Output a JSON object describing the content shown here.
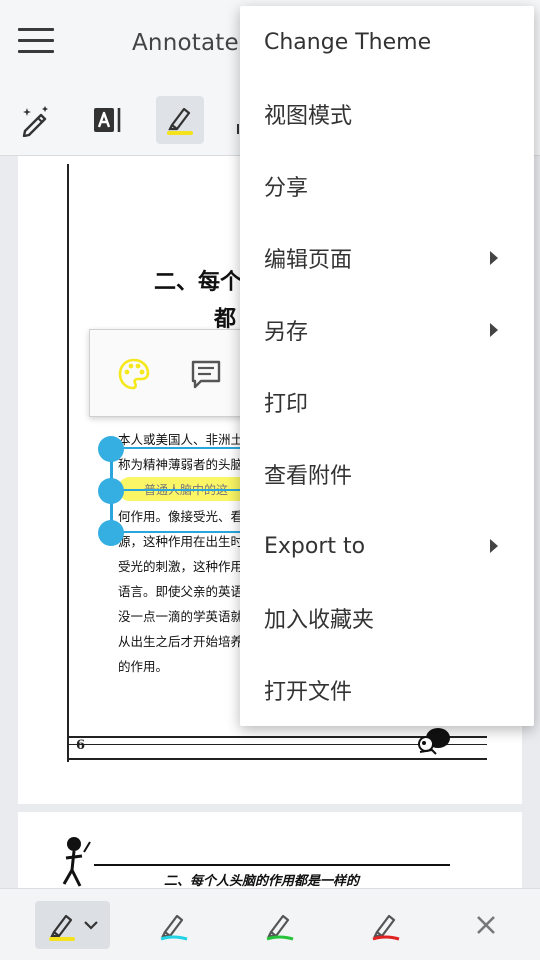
{
  "app_bar": {
    "title": "Annotate",
    "menu_icon": "hamburger-menu-icon",
    "tools": [
      {
        "name": "magic-pen-icon",
        "active": false
      },
      {
        "name": "text-cursor-icon",
        "active": false
      },
      {
        "name": "highlighter-icon",
        "active": true
      }
    ]
  },
  "document": {
    "heading_line1": "二、每个",
    "heading_line2": "都",
    "lines": [
      "本人或美国人、非洲土",
      "称为精神薄弱者的头脑",
      "何作用。像接受光、看",
      "源，这种作用在出生时",
      "受光的刺激，这种作用",
      "语言。即使父亲的英语",
      "没一点一滴的学英语就",
      "从出生之后才开始培养",
      "的作用。"
    ],
    "highlighted_text": "普通人脑中的这",
    "page_number": "6",
    "page2_heading": "二、每个人头脑的作用都是一样的"
  },
  "annotation_popup": {
    "buttons": [
      "palette-icon",
      "comment-icon"
    ],
    "palette_color": "#f5e81c"
  },
  "overflow_menu": {
    "items": [
      {
        "label": "Change Theme",
        "submenu": false
      },
      {
        "label": "视图模式",
        "submenu": false
      },
      {
        "label": "分享",
        "submenu": false
      },
      {
        "label": "编辑页面",
        "submenu": true
      },
      {
        "label": "另存",
        "submenu": true
      },
      {
        "label": "打印",
        "submenu": false
      },
      {
        "label": "查看附件",
        "submenu": false
      },
      {
        "label": "Export to",
        "submenu": true
      },
      {
        "label": "加入收藏夹",
        "submenu": false
      },
      {
        "label": "打开文件",
        "submenu": false
      }
    ]
  },
  "bottom_toolbar": {
    "pens": [
      {
        "name": "pen-yellow-icon",
        "color": "#f3e21c",
        "active": true
      },
      {
        "name": "pen-cyan-icon",
        "color": "#22d3e6",
        "active": false
      },
      {
        "name": "pen-green-icon",
        "color": "#27c43b",
        "active": false
      },
      {
        "name": "pen-red-icon",
        "color": "#e02222",
        "active": false
      }
    ],
    "close_icon": "close-icon"
  },
  "colors": {
    "accent_blue": "#35aee2",
    "highlight_yellow": "#f9f54a"
  }
}
